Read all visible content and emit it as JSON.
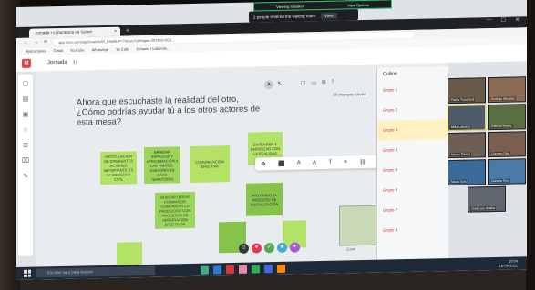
{
  "zoom": {
    "bar_left": "Viewing Speaker",
    "bar_right": "View Options",
    "waiting": "2 people entered the waiting room",
    "view_button": "View"
  },
  "browser": {
    "tab_title": "Jornada • Laboratorio de Gober",
    "url": "app.miro.com/app/board/o9J_lbfw8L8=/?moveToWidget=3074457358...",
    "bookmarks": [
      "Aplicaciones",
      "Gmail",
      "YouTube",
      "WhatsApp",
      "Ya Cafe",
      "Jornada • Laborato..."
    ]
  },
  "miro": {
    "board_name": "Jornada",
    "changes_saved": "All changes saved",
    "outline_button": "Outline",
    "question": "Ahora que escuchaste la realidad del otro, ¿Cómo podrías ayudar tú a los otros actores de esta mesa?",
    "notes": [
      "ARTICULACIÓN DE DIFERENTES ACTORES IMPORTANTE ES LA SOCIEDAD CIVIL",
      "BRINDAR ESPACIOS Y APROXIMACIÓN A LAS PARTES, ASESORÍA EN CADA TERRITORIO",
      "COMUNICACIÓN EFECTIVA",
      "ENTENDER Y EMPATIZAR CON LA REALIDAD",
      "BUSCAR OTRAS FORMAS DE COMUNICAR LO PRODUCIDO CON PROCESOS DE APROPIACIÓN EFECTIVOS",
      "APOYANDO EL PROCESO DE SOCIALIZACIÓN"
    ],
    "groups": [
      "Grupo 1",
      "Grupo 2",
      "Grupo 3",
      "Grupo 4",
      "Grupo 5",
      "Grupo 6",
      "Grupo 7",
      "Grupo 8"
    ],
    "selected_group_index": 2,
    "zoom_level": "Zoom"
  },
  "participants": [
    {
      "name": "Pabla Tronchoni"
    },
    {
      "name": "Rodrigo Morales"
    },
    {
      "name": "Mika Labarca"
    },
    {
      "name": "Patricia Reyes"
    },
    {
      "name": "Mauro Toledo"
    },
    {
      "name": "Carmen Oda"
    },
    {
      "name": "Maria Gonz"
    },
    {
      "name": "Daniela Toro"
    },
    {
      "name": "Jose Luis Urbina"
    }
  ],
  "taskbar": {
    "search_placeholder": "Escribe aquí para buscar",
    "time": "10:04",
    "date": "18-09-2021"
  }
}
